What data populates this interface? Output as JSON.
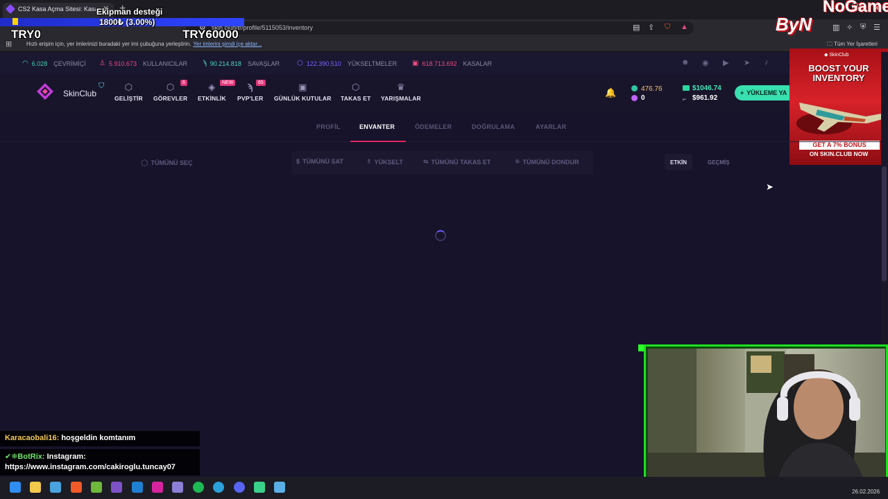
{
  "browser": {
    "tab_title": "CS2 Kasa Açma Sitesi: Kasa Açm",
    "url": "skin.club/tr/profile/5115053/inventory",
    "bookmark_hint": "Hızlı erişim için, yer imlerinizi buradaki yer imi çubuğuna yerleştirin.",
    "bookmark_link": "Yer imlerini şimdi içe aktar...",
    "bookmark_folder": "Tüm Yer İşaretleri"
  },
  "stream_overlay": {
    "support_title": "Ekipman desteği",
    "support_amount": "1800₺ (3.00%)",
    "support_progress": 0.03,
    "support_min": "TRY0",
    "support_max": "TRY60000",
    "logo_text": "ByN",
    "logo_top": "NoGame"
  },
  "stats": [
    {
      "value": "6.028",
      "label": "ÇEVRİMİÇİ",
      "color": "#3fd4b0",
      "icon": "signal-icon"
    },
    {
      "value": "5.910.673",
      "label": "KULLANICILAR",
      "color": "#e94c7e",
      "icon": "user-icon"
    },
    {
      "value": "90.214.818",
      "label": "SAVAŞLAR",
      "color": "#4fd6c5",
      "icon": "battle-icon"
    },
    {
      "value": "122.390.510",
      "label": "YÜKSELTMELER",
      "color": "#7e63ff",
      "icon": "upgrade-icon"
    },
    {
      "value": "618.713.692",
      "label": "KASALAR",
      "color": "#e94c7e",
      "icon": "case-icon"
    }
  ],
  "logo": {
    "text": "SkinClub"
  },
  "nav": [
    {
      "label": "GELİŞTİR",
      "badge": ""
    },
    {
      "label": "GÖREVLER",
      "badge": "6"
    },
    {
      "label": "ETKİNLİK",
      "badge": "NEW"
    },
    {
      "label": "PVP'LER",
      "badge": "65"
    },
    {
      "label": "GÜNLÜK KUTULAR",
      "badge": ""
    },
    {
      "label": "TAKAS ET",
      "badge": ""
    },
    {
      "label": "YARIŞMALAR",
      "badge": ""
    }
  ],
  "wallet": {
    "coins": "476.76",
    "gems": "0",
    "balance": "$1046.74",
    "secondary_balance": "$961.92",
    "deposit_label": "YÜKLEME YA"
  },
  "ad": {
    "logo": "SkinClub",
    "headline": "BOOST YOUR INVENTORY",
    "bonus": "GET A 7% BONUS",
    "cta": "ON SKIN.CLUB NOW"
  },
  "profile_tabs": [
    "PROFİL",
    "ENVANTER",
    "ÖDEMELER",
    "DOĞRULAMA",
    "AYARLAR"
  ],
  "active_profile_tab": "ENVANTER",
  "actions": {
    "select_all": "TÜMÜNÜ SEÇ",
    "sell_all": "TÜMÜNÜ SAT",
    "upgrade": "YÜKSELT",
    "trade_all": "TÜMÜNÜ TAKAS ET",
    "freeze_all": "TÜMÜNÜ DONDUR"
  },
  "filters": {
    "active": "ETKİN",
    "history": "GEÇMİŞ"
  },
  "chat": [
    {
      "user": "Karacaobali16:",
      "message": "hoşgeldin komtanım"
    },
    {
      "user": "✔❄BotRix:",
      "message": "Instagram: https://www.instagram.com/cakiroglu.tuncay07"
    }
  ],
  "taskbar": {
    "date": "26.02.2026"
  }
}
